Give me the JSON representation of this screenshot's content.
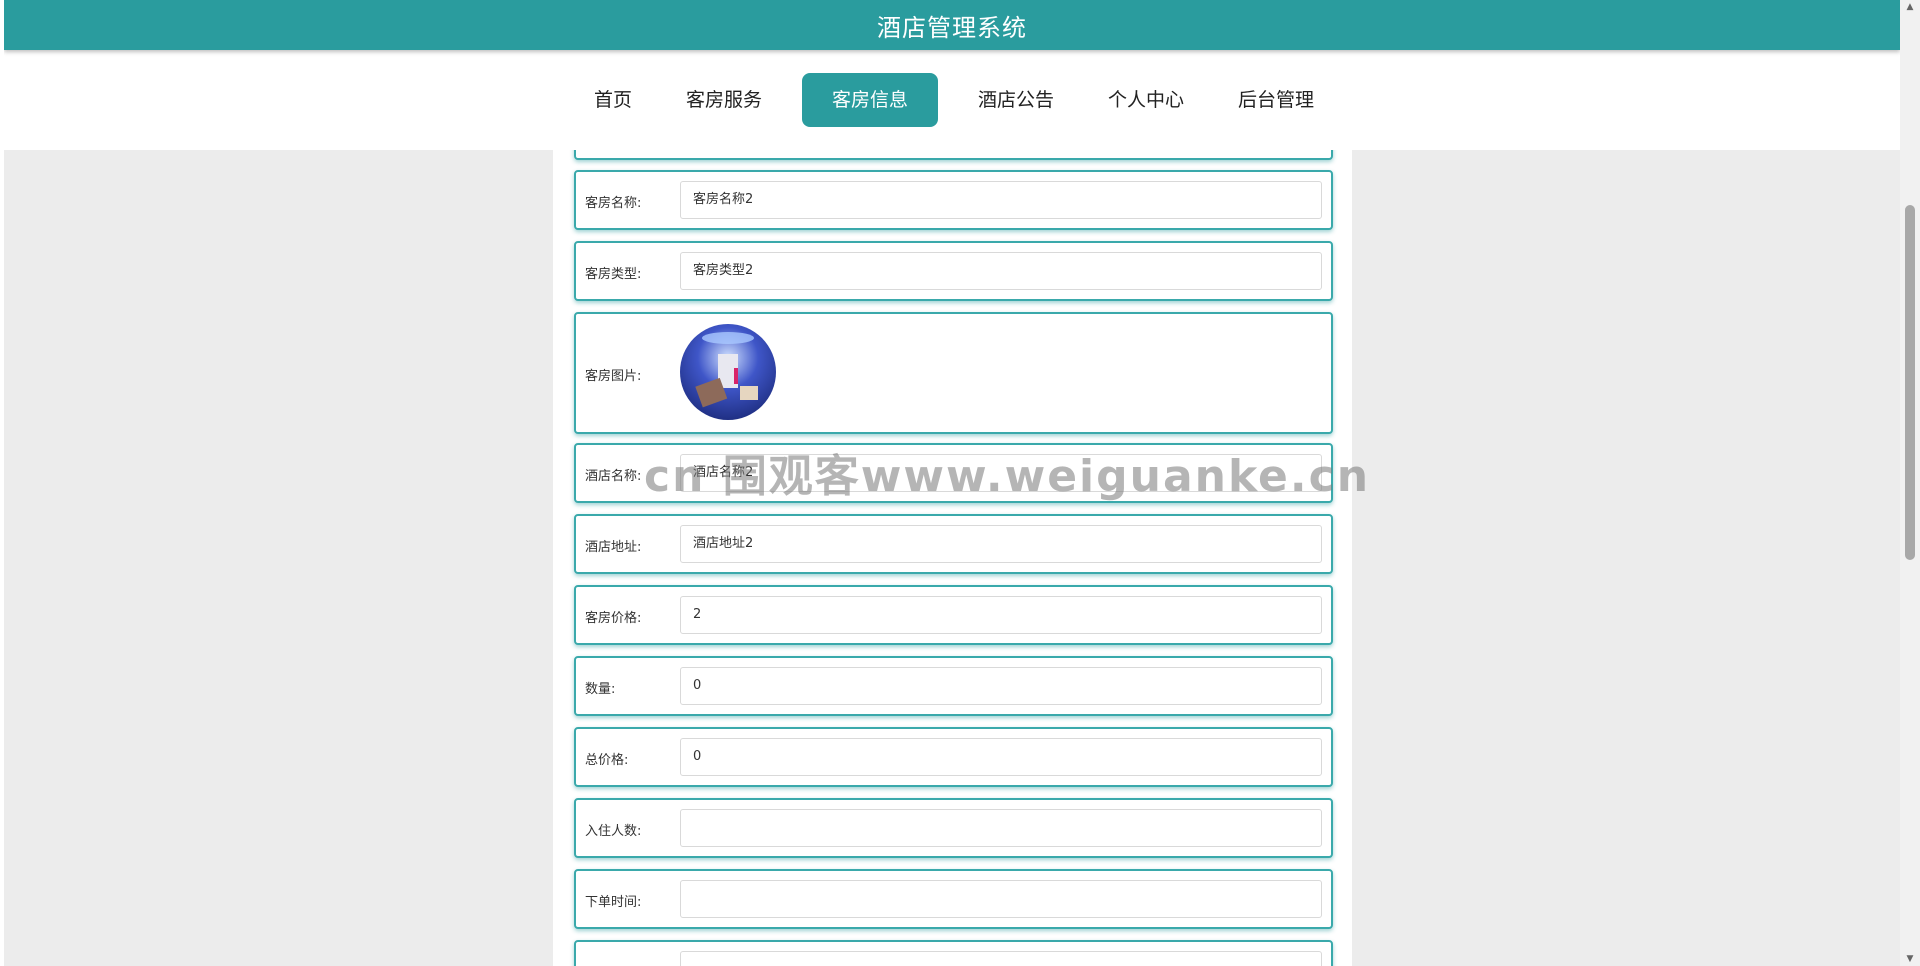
{
  "header": {
    "title": "酒店管理系统"
  },
  "nav": {
    "items": [
      {
        "label": "首页"
      },
      {
        "label": "客房服务"
      },
      {
        "label": "客房信息"
      },
      {
        "label": "酒店公告"
      },
      {
        "label": "个人中心"
      },
      {
        "label": "后台管理"
      }
    ],
    "active": "客房信息"
  },
  "form": {
    "room_name": {
      "label": "客房名称:",
      "value": "客房名称2"
    },
    "room_type": {
      "label": "客房类型:",
      "value": "客房类型2"
    },
    "room_image": {
      "label": "客房图片:"
    },
    "hotel_name": {
      "label": "酒店名称:",
      "value": "酒店名称2"
    },
    "hotel_address": {
      "label": "酒店地址:",
      "value": "酒店地址2"
    },
    "room_price": {
      "label": "客房价格:",
      "value": "2"
    },
    "quantity": {
      "label": "数量:",
      "value": "0"
    },
    "total_price": {
      "label": "总价格:",
      "value": "0"
    },
    "guests": {
      "label": "入住人数:",
      "value": ""
    },
    "order_time": {
      "label": "下单时间:",
      "value": ""
    }
  },
  "watermark": "cn 围观客www.weiguanke.cn",
  "colors": {
    "accent": "#2a9c9e",
    "background": "#ececec"
  }
}
